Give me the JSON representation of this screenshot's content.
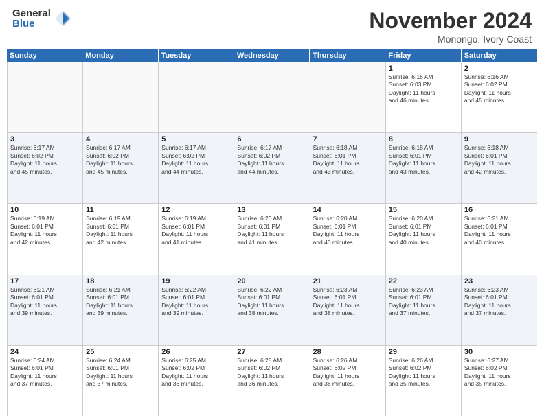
{
  "header": {
    "logo_general": "General",
    "logo_blue": "Blue",
    "month_title": "November 2024",
    "location": "Monongo, Ivory Coast"
  },
  "days_of_week": [
    "Sunday",
    "Monday",
    "Tuesday",
    "Wednesday",
    "Thursday",
    "Friday",
    "Saturday"
  ],
  "weeks": [
    [
      {
        "day": "",
        "info": "",
        "empty": true
      },
      {
        "day": "",
        "info": "",
        "empty": true
      },
      {
        "day": "",
        "info": "",
        "empty": true
      },
      {
        "day": "",
        "info": "",
        "empty": true
      },
      {
        "day": "",
        "info": "",
        "empty": true
      },
      {
        "day": "1",
        "info": "Sunrise: 6:16 AM\nSunset: 6:03 PM\nDaylight: 11 hours\nand 46 minutes.",
        "empty": false
      },
      {
        "day": "2",
        "info": "Sunrise: 6:16 AM\nSunset: 6:02 PM\nDaylight: 11 hours\nand 45 minutes.",
        "empty": false
      }
    ],
    [
      {
        "day": "3",
        "info": "Sunrise: 6:17 AM\nSunset: 6:02 PM\nDaylight: 11 hours\nand 45 minutes.",
        "empty": false
      },
      {
        "day": "4",
        "info": "Sunrise: 6:17 AM\nSunset: 6:02 PM\nDaylight: 11 hours\nand 45 minutes.",
        "empty": false
      },
      {
        "day": "5",
        "info": "Sunrise: 6:17 AM\nSunset: 6:02 PM\nDaylight: 11 hours\nand 44 minutes.",
        "empty": false
      },
      {
        "day": "6",
        "info": "Sunrise: 6:17 AM\nSunset: 6:02 PM\nDaylight: 11 hours\nand 44 minutes.",
        "empty": false
      },
      {
        "day": "7",
        "info": "Sunrise: 6:18 AM\nSunset: 6:01 PM\nDaylight: 11 hours\nand 43 minutes.",
        "empty": false
      },
      {
        "day": "8",
        "info": "Sunrise: 6:18 AM\nSunset: 6:01 PM\nDaylight: 11 hours\nand 43 minutes.",
        "empty": false
      },
      {
        "day": "9",
        "info": "Sunrise: 6:18 AM\nSunset: 6:01 PM\nDaylight: 11 hours\nand 42 minutes.",
        "empty": false
      }
    ],
    [
      {
        "day": "10",
        "info": "Sunrise: 6:19 AM\nSunset: 6:01 PM\nDaylight: 11 hours\nand 42 minutes.",
        "empty": false
      },
      {
        "day": "11",
        "info": "Sunrise: 6:19 AM\nSunset: 6:01 PM\nDaylight: 11 hours\nand 42 minutes.",
        "empty": false
      },
      {
        "day": "12",
        "info": "Sunrise: 6:19 AM\nSunset: 6:01 PM\nDaylight: 11 hours\nand 41 minutes.",
        "empty": false
      },
      {
        "day": "13",
        "info": "Sunrise: 6:20 AM\nSunset: 6:01 PM\nDaylight: 11 hours\nand 41 minutes.",
        "empty": false
      },
      {
        "day": "14",
        "info": "Sunrise: 6:20 AM\nSunset: 6:01 PM\nDaylight: 11 hours\nand 40 minutes.",
        "empty": false
      },
      {
        "day": "15",
        "info": "Sunrise: 6:20 AM\nSunset: 6:01 PM\nDaylight: 11 hours\nand 40 minutes.",
        "empty": false
      },
      {
        "day": "16",
        "info": "Sunrise: 6:21 AM\nSunset: 6:01 PM\nDaylight: 11 hours\nand 40 minutes.",
        "empty": false
      }
    ],
    [
      {
        "day": "17",
        "info": "Sunrise: 6:21 AM\nSunset: 6:01 PM\nDaylight: 11 hours\nand 39 minutes.",
        "empty": false
      },
      {
        "day": "18",
        "info": "Sunrise: 6:21 AM\nSunset: 6:01 PM\nDaylight: 11 hours\nand 39 minutes.",
        "empty": false
      },
      {
        "day": "19",
        "info": "Sunrise: 6:22 AM\nSunset: 6:01 PM\nDaylight: 11 hours\nand 39 minutes.",
        "empty": false
      },
      {
        "day": "20",
        "info": "Sunrise: 6:22 AM\nSunset: 6:01 PM\nDaylight: 11 hours\nand 38 minutes.",
        "empty": false
      },
      {
        "day": "21",
        "info": "Sunrise: 6:23 AM\nSunset: 6:01 PM\nDaylight: 11 hours\nand 38 minutes.",
        "empty": false
      },
      {
        "day": "22",
        "info": "Sunrise: 6:23 AM\nSunset: 6:01 PM\nDaylight: 11 hours\nand 37 minutes.",
        "empty": false
      },
      {
        "day": "23",
        "info": "Sunrise: 6:23 AM\nSunset: 6:01 PM\nDaylight: 11 hours\nand 37 minutes.",
        "empty": false
      }
    ],
    [
      {
        "day": "24",
        "info": "Sunrise: 6:24 AM\nSunset: 6:01 PM\nDaylight: 11 hours\nand 37 minutes.",
        "empty": false
      },
      {
        "day": "25",
        "info": "Sunrise: 6:24 AM\nSunset: 6:01 PM\nDaylight: 11 hours\nand 37 minutes.",
        "empty": false
      },
      {
        "day": "26",
        "info": "Sunrise: 6:25 AM\nSunset: 6:02 PM\nDaylight: 11 hours\nand 36 minutes.",
        "empty": false
      },
      {
        "day": "27",
        "info": "Sunrise: 6:25 AM\nSunset: 6:02 PM\nDaylight: 11 hours\nand 36 minutes.",
        "empty": false
      },
      {
        "day": "28",
        "info": "Sunrise: 6:26 AM\nSunset: 6:02 PM\nDaylight: 11 hours\nand 36 minutes.",
        "empty": false
      },
      {
        "day": "29",
        "info": "Sunrise: 6:26 AM\nSunset: 6:02 PM\nDaylight: 11 hours\nand 35 minutes.",
        "empty": false
      },
      {
        "day": "30",
        "info": "Sunrise: 6:27 AM\nSunset: 6:02 PM\nDaylight: 11 hours\nand 35 minutes.",
        "empty": false
      }
    ]
  ]
}
